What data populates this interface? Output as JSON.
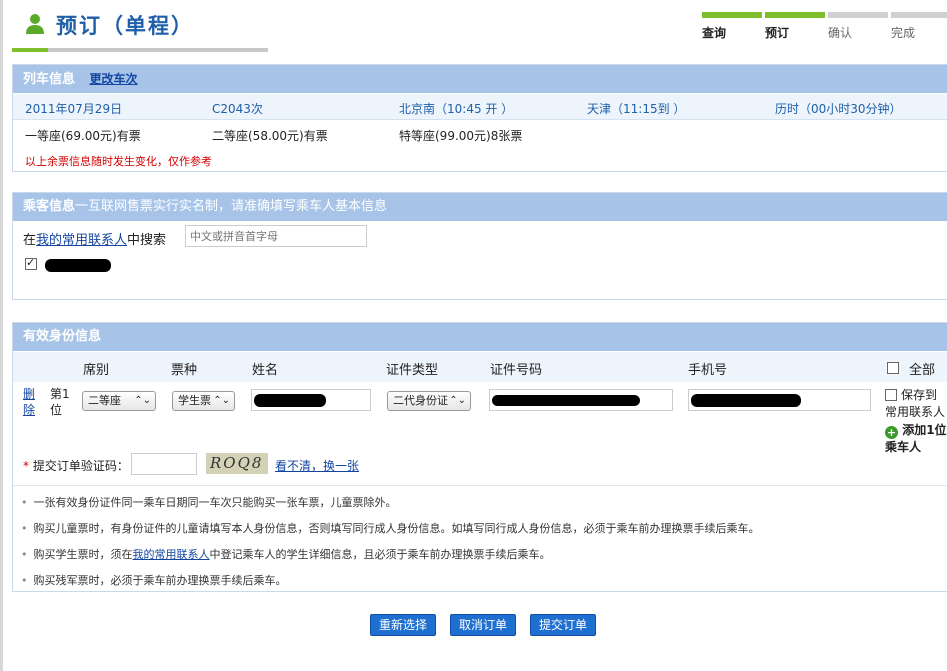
{
  "header": {
    "title": "预订（单程）",
    "steps": [
      {
        "label": "查询",
        "done": true
      },
      {
        "label": "预订",
        "done": true
      },
      {
        "label": "确认",
        "done": false
      },
      {
        "label": "完成",
        "done": false
      }
    ]
  },
  "train": {
    "title": "列车信息",
    "change_link": "更改车次",
    "date": "2011年07月29日",
    "number": "C2043次",
    "from": "北京南（10:45 开 ）",
    "to": "天津（11:15到 ）",
    "duration": "历时（00小时30分钟）",
    "seats": [
      "一等座(69.00元)有票",
      "二等座(58.00元)有票",
      "特等座(99.00元)8张票"
    ],
    "warning": "以上余票信息随时发生变化，仅作参考"
  },
  "passenger": {
    "title": "乘客信息",
    "title_note": "一互联网售票实行实名制，请准确填写乘车人基本信息",
    "search_prefix": "在",
    "search_link": "我的常用联系人",
    "search_suffix": "中搜索",
    "search_placeholder": "中文或拼音首字母"
  },
  "identity": {
    "title": "有效身份信息",
    "columns": {
      "seat": "席别",
      "ticket": "票种",
      "name": "姓名",
      "id_type": "证件类型",
      "id_number": "证件号码",
      "phone": "手机号",
      "all": "全部"
    },
    "row": {
      "delete": "删除",
      "seq": "第1位",
      "seat": "二等座",
      "ticket": "学生票",
      "id_type": "二代身份证"
    },
    "save_label": "保存到常用联系人",
    "add_label": "添加1位乘车人",
    "captcha_label": "提交订单验证码：",
    "captcha_text": "ROQ8",
    "captcha_refresh": "看不清，换一张",
    "notes": [
      "一张有效身份证件同一乘车日期同一车次只能购买一张车票，儿童票除外。",
      "购买儿童票时，有身份证件的儿童请填写本人身份信息，否则填写同行成人身份信息。如填写同行成人身份信息，必须于乘车前办理换票手续后乘车。"
    ],
    "note_student_prefix": "购买学生票时，须在",
    "note_student_link": "我的常用联系人",
    "note_student_suffix": "中登记乘车人的学生详细信息，且必须于乘车前办理换票手续后乘车。",
    "note_military": "购买残军票时，必须于乘车前办理换票手续后乘车。"
  },
  "buttons": {
    "reselect": "重新选择",
    "cancel": "取消订单",
    "submit": "提交订单"
  },
  "colors": {
    "panel_header": "#a7c4e8",
    "progress_done": "#7fbf2b",
    "button": "#1f6fd1",
    "link": "#1446a0",
    "warning": "#d40000"
  }
}
